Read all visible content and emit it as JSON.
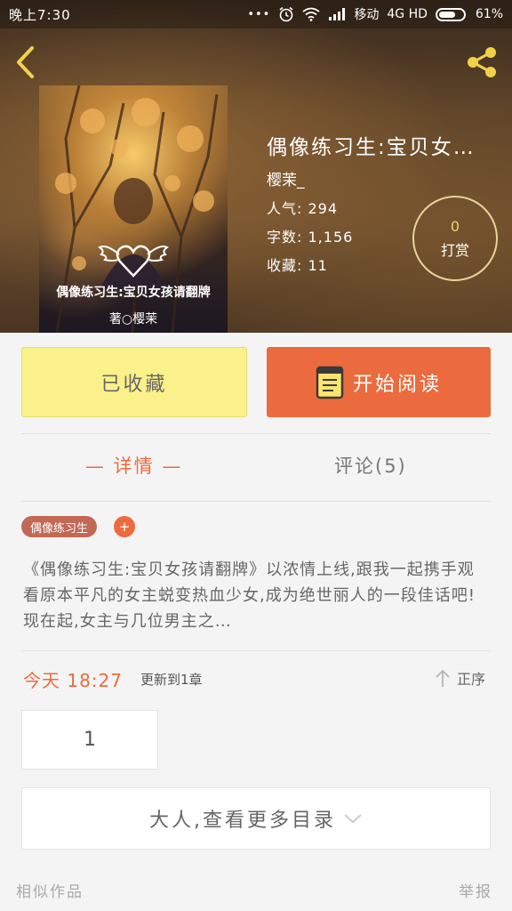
{
  "status_bar": {
    "time": "晚上7:30",
    "dots": "•••",
    "carrier": "移动",
    "network": "4G HD",
    "battery": "61%"
  },
  "book": {
    "title": "偶像练习生:宝贝女…",
    "cover_title": "偶像练习生:宝贝女孩请翻牌",
    "cover_author": "著○樱茉",
    "author": "樱茉_",
    "popularity_label": "人气:",
    "popularity": "294",
    "words_label": "字数:",
    "words": "1,156",
    "favorites_label": "收藏:",
    "favorites": "11"
  },
  "tip": {
    "count": "0",
    "label": "打赏"
  },
  "actions": {
    "collected_label": "已收藏",
    "read_label": "开始阅读"
  },
  "tabs": {
    "detail": "— 详情 —",
    "comments": "评论(5)"
  },
  "tag": {
    "label": "偶像练习生",
    "add": "+"
  },
  "synopsis": "《偶像练习生:宝贝女孩请翻牌》以浓情上线,跟我一起携手观看原本平凡的女主蜕变热血少女,成为绝世丽人的一段佳话吧!现在起,女主与几位男主之…",
  "update": {
    "time": "今天 18:27",
    "text": "更新到1章",
    "sort_label": "正序"
  },
  "chapter": {
    "number": "1"
  },
  "more_toc": {
    "label": "大人,查看更多目录"
  },
  "footer": {
    "similar": "相似作品",
    "report": "举报"
  },
  "colors": {
    "accent": "#ec6b3e",
    "collected_bg": "#fbf18a",
    "tag_bg": "#c26956"
  }
}
